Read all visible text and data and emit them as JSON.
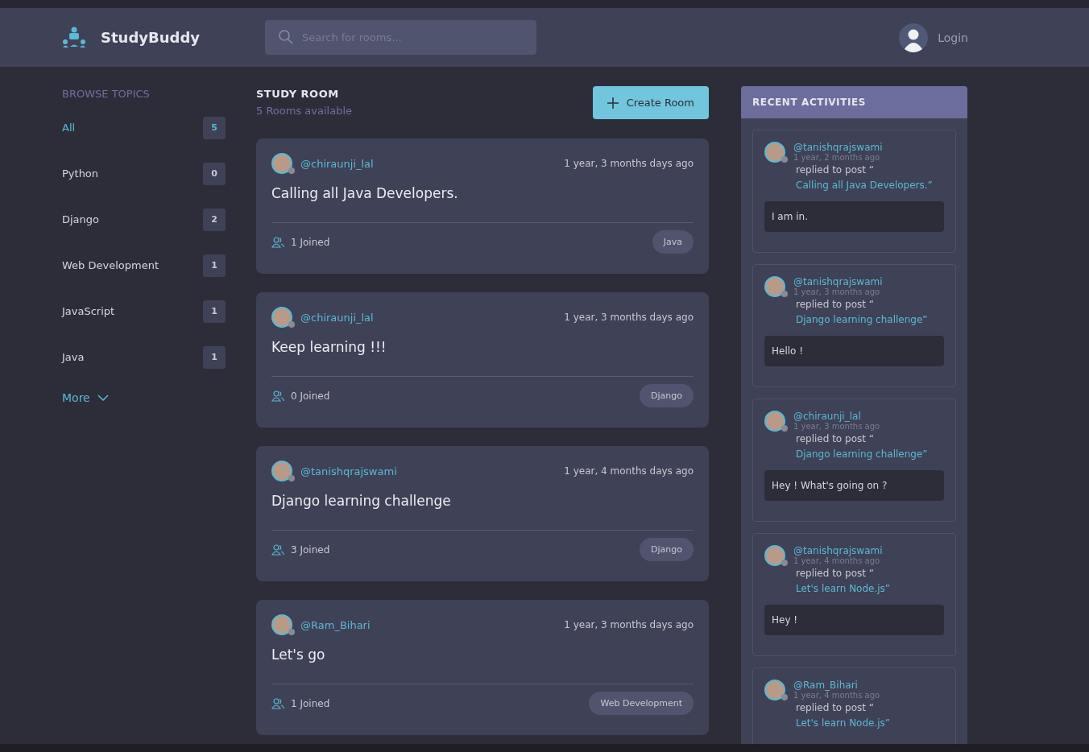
{
  "brand": {
    "name": "StudyBuddy"
  },
  "search": {
    "placeholder": "Search for rooms..."
  },
  "user": {
    "label": "Login"
  },
  "topics": {
    "title": "BROWSE TOPICS",
    "more": "More",
    "items": [
      {
        "name": "All",
        "count": "5",
        "selected": true
      },
      {
        "name": "Python",
        "count": "0",
        "selected": false
      },
      {
        "name": "Django",
        "count": "2",
        "selected": false
      },
      {
        "name": "Web Development",
        "count": "1",
        "selected": false
      },
      {
        "name": "JavaScript",
        "count": "1",
        "selected": false
      },
      {
        "name": "Java",
        "count": "1",
        "selected": false
      }
    ]
  },
  "rooms": {
    "title": "STUDY ROOM",
    "subtitle": "5 Rooms available",
    "create": "Create Room",
    "items": [
      {
        "host": "@chiraunji_lal",
        "time": "1 year, 3 months days ago",
        "name": "Calling all Java Developers.",
        "joined": "1 Joined",
        "topic": "Java"
      },
      {
        "host": "@chiraunji_lal",
        "time": "1 year, 3 months days ago",
        "name": "Keep learning !!!",
        "joined": "0 Joined",
        "topic": "Django"
      },
      {
        "host": "@tanishqrajswami",
        "time": "1 year, 4 months days ago",
        "name": "Django learning challenge",
        "joined": "3 Joined",
        "topic": "Django"
      },
      {
        "host": "@Ram_Bihari",
        "time": "1 year, 3 months days ago",
        "name": "Let's go",
        "joined": "1 Joined",
        "topic": "Web Development"
      }
    ]
  },
  "activities": {
    "title": "RECENT ACTIVITIES",
    "items": [
      {
        "user": "@tanishqrajswami",
        "time": "1 year, 2 months ago",
        "action": "replied to post “",
        "post": "Calling all Java Developers.”",
        "message": "I am in."
      },
      {
        "user": "@tanishqrajswami",
        "time": "1 year, 3 months ago",
        "action": "replied to post “",
        "post": "Django learning challenge”",
        "message": "Hello !"
      },
      {
        "user": "@chiraunji_lal",
        "time": "1 year, 3 months ago",
        "action": "replied to post “",
        "post": "Django learning challenge”",
        "message": "Hey ! What's going on ?"
      },
      {
        "user": "@tanishqrajswami",
        "time": "1 year, 4 months ago",
        "action": "replied to post “",
        "post": "Let's learn Node.js”",
        "message": "Hey !"
      },
      {
        "user": "@Ram_Bihari",
        "time": "1 year, 4 months ago",
        "action": "replied to post “",
        "post": "Let's learn Node.js”"
      }
    ]
  }
}
